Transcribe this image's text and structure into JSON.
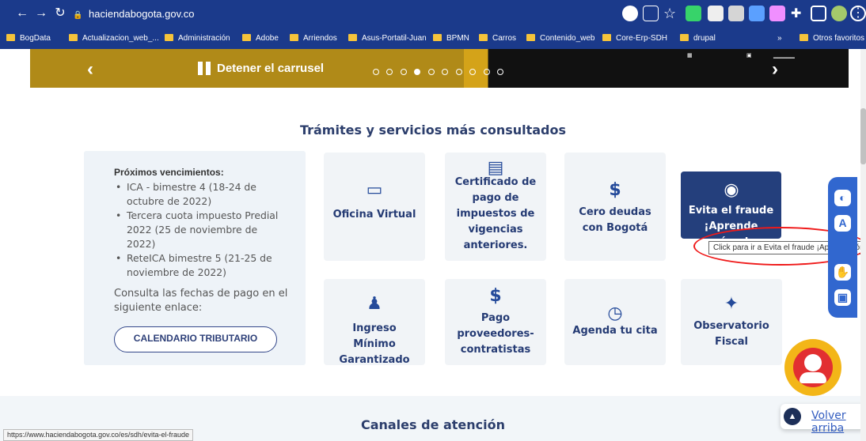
{
  "browser": {
    "url": "haciendabogota.gov.co",
    "bookmarks": [
      "BogData",
      "Actualizacion_web_...",
      "Administración",
      "Adobe",
      "Arriendos",
      "Asus-Portatil-Juan",
      "BPMN",
      "Carros",
      "Contenido_web",
      "Core-Erp-SDH",
      "drupal",
      "Otros favoritos"
    ],
    "overflow": "»",
    "status_link": "https://www.haciendabogota.gov.co/es/sdh/evita-el-fraude"
  },
  "carousel": {
    "pause_label": "Detener el carrusel",
    "dots": 10,
    "active_dot": 4
  },
  "page": {
    "section_title": "Trámites y servicios más consultados",
    "bottom_title": "Canales de atención",
    "info": {
      "title": "Próximos vencimientos:",
      "items": [
        "ICA - bimestre 4 (18-24 de octubre de 2022)",
        "Tercera cuota impuesto Predial 2022 (25 de noviembre de 2022)",
        "ReteICA bimestre 5 (21-25 de noviembre de 2022)"
      ],
      "note": "Consulta las fechas de pago en el siguiente enlace:",
      "button": "CALENDARIO TRIBUTARIO"
    },
    "cards": [
      {
        "label": "Oficina Virtual",
        "icon": "computer-icon"
      },
      {
        "label": "Certificado de pago de impuestos de vigencias anteriores.",
        "icon": "certificate-icon"
      },
      {
        "label": "Cero deudas con Bogotá",
        "icon": "hand-money-icon"
      },
      {
        "label": "Evita el fraude ¡Aprende cómo!",
        "icon": "mask-icon"
      },
      {
        "label": "Ingreso Mínimo Garantizado",
        "icon": "family-icon"
      },
      {
        "label": "Pago proveedores-contratistas",
        "icon": "money-icon"
      },
      {
        "label": "Agenda tu cita",
        "icon": "clock-icon"
      },
      {
        "label": "Observatorio Fiscal",
        "icon": "telescope-icon"
      }
    ],
    "tooltip": "Click para ir a Evita el fraude ¡Aprende cómo!",
    "back_to_top": "Volver arriba"
  }
}
